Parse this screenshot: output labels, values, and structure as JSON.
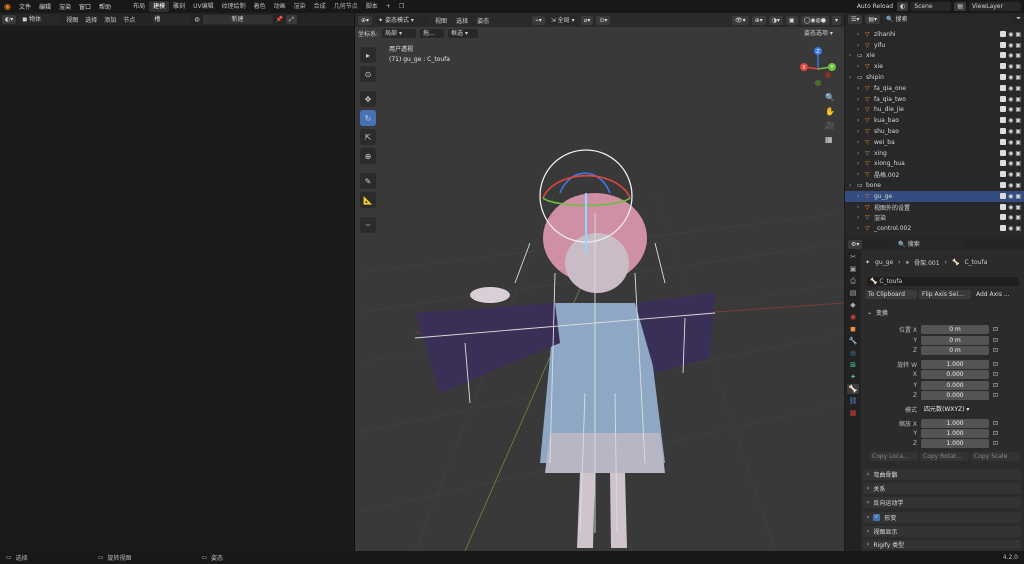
{
  "topbar": {
    "menus": [
      "文件",
      "编辑",
      "渲染",
      "窗口",
      "帮助"
    ],
    "workspaces": [
      "布局",
      "建模",
      "雕刻",
      "UV编辑",
      "纹理绘制",
      "着色",
      "动画",
      "渲染",
      "合成",
      "几何节点",
      "脚本"
    ],
    "active_workspace": "建模",
    "auto_reload": "Auto Reload",
    "scene": "Scene",
    "view_layer": "ViewLayer"
  },
  "left_header": {
    "mode": "物体",
    "menus": [
      "视图",
      "选择",
      "添加",
      "节点"
    ],
    "slot": "槽",
    "new_button": "新建"
  },
  "viewport": {
    "mode": "姿态模式",
    "menus": [
      "视图",
      "选择",
      "姿态"
    ],
    "orientation": "全局",
    "transform_label": "坐标系:",
    "transform_value": "局部",
    "pivot": "拖...",
    "drag": "框选",
    "options": "姿态选项",
    "overlay_title": "用户透视",
    "overlay_sub": "(71) gu_ge : C_toufa",
    "gizmo_labels": [
      "Z",
      "Y",
      "X"
    ]
  },
  "outliner": {
    "search_placeholder": "搜索",
    "rows": [
      {
        "name": "zihanhi",
        "indent": 1,
        "sel": false
      },
      {
        "name": "yifu",
        "indent": 1,
        "sel": false
      },
      {
        "name": "xie",
        "indent": 0,
        "sel": false
      },
      {
        "name": "xie",
        "indent": 1,
        "sel": false
      },
      {
        "name": "shipin",
        "indent": 0,
        "sel": false
      },
      {
        "name": "fa_qia_one",
        "indent": 1,
        "sel": false
      },
      {
        "name": "fa_qia_two",
        "indent": 1,
        "sel": false
      },
      {
        "name": "hu_die_jie",
        "indent": 1,
        "sel": false
      },
      {
        "name": "kua_bao",
        "indent": 1,
        "sel": false
      },
      {
        "name": "shu_bao",
        "indent": 1,
        "sel": false
      },
      {
        "name": "wei_ba",
        "indent": 1,
        "sel": false
      },
      {
        "name": "xing",
        "indent": 1,
        "sel": false
      },
      {
        "name": "xiong_hua",
        "indent": 1,
        "sel": false
      },
      {
        "name": "晶格.002",
        "indent": 1,
        "sel": false
      },
      {
        "name": "bone",
        "indent": 0,
        "sel": false
      },
      {
        "name": "gu_ge",
        "indent": 1,
        "sel": true
      },
      {
        "name": "视图外的设置",
        "indent": 1,
        "sel": false
      },
      {
        "name": "渲染",
        "indent": 1,
        "sel": false
      },
      {
        "name": "_control.002",
        "indent": 1,
        "sel": false
      }
    ]
  },
  "properties": {
    "search_placeholder": "搜索",
    "breadcrumb": [
      "gu_ge",
      "骨架.001",
      "C_toufa"
    ],
    "bone_name": "C_toufa",
    "actions": [
      "To Clipboard",
      "Flip Axis Sel...",
      "Add Axis ..."
    ],
    "transform_panel": "变换",
    "location": {
      "label": "位置 X",
      "y": "Y",
      "z": "Z",
      "vals": [
        "0 m",
        "0 m",
        "0 m"
      ]
    },
    "rotation": {
      "label": "旋转 W",
      "x": "X",
      "y": "Y",
      "z": "Z",
      "vals": [
        "1.000",
        "0.000",
        "0.000",
        "0.000"
      ]
    },
    "mode": {
      "label": "模式",
      "value": "四元数(WXYZ)"
    },
    "scale": {
      "label": "缩放 X",
      "y": "Y",
      "z": "Z",
      "vals": [
        "1.000",
        "1.000",
        "1.000"
      ]
    },
    "copy_buttons": [
      "Copy Loca...",
      "Copy Rotat...",
      "Copy Scale"
    ],
    "panels": [
      "弯曲骨骼",
      "关系",
      "反向运动学",
      "形变",
      "视图显示",
      "Rigify 类型"
    ],
    "deform_checked": true
  },
  "status": {
    "items": [
      "选择",
      "旋转视图",
      "姿态"
    ],
    "version": "4.2.0"
  }
}
